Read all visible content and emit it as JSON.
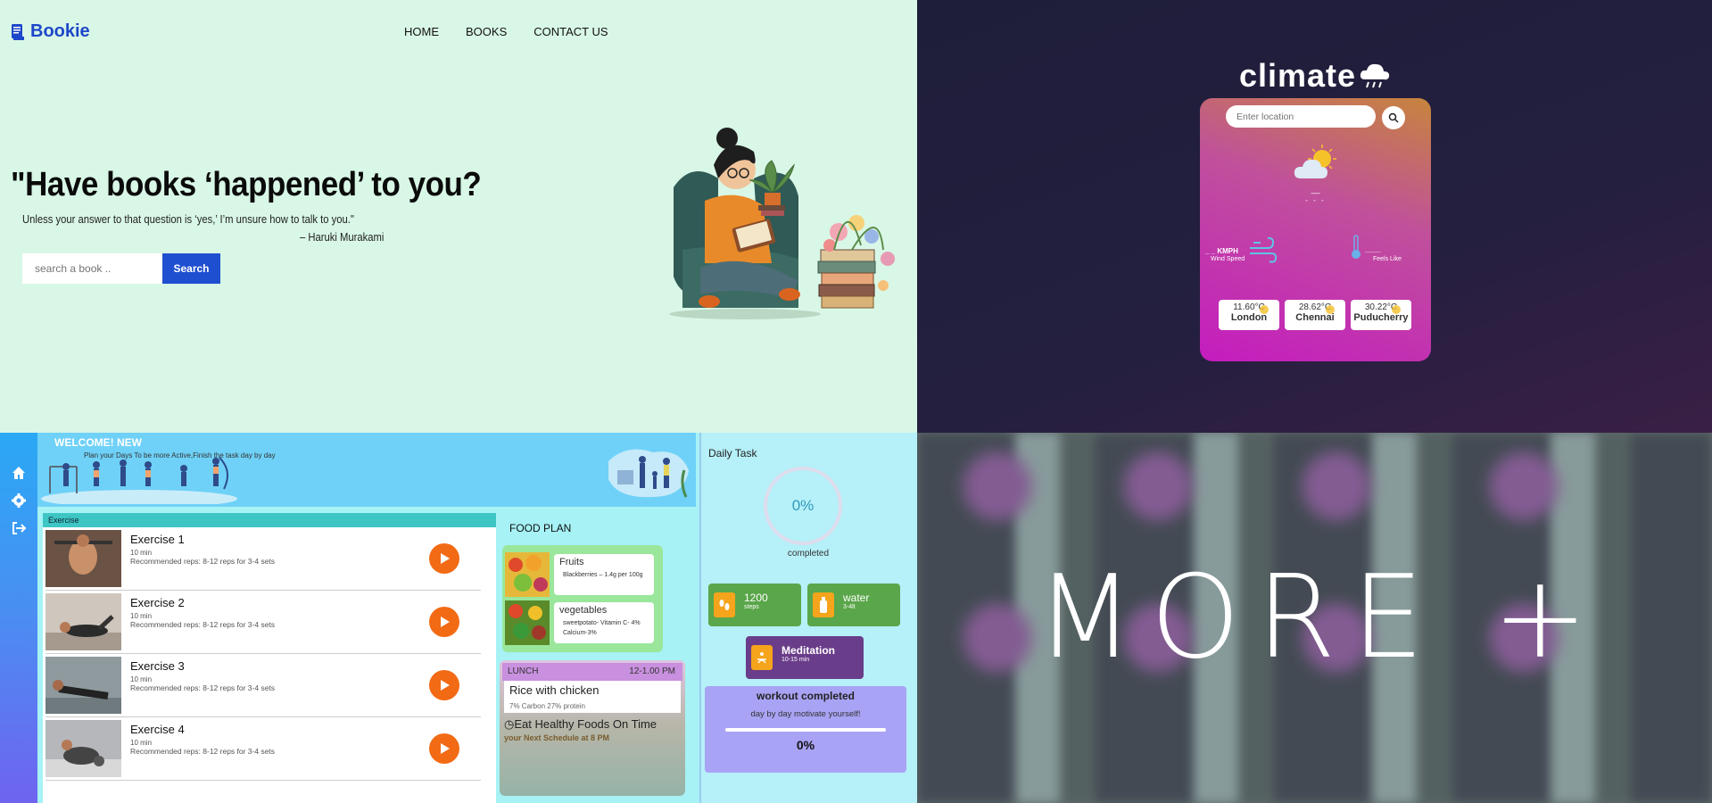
{
  "bookie": {
    "logo_text": "Bookie",
    "nav": [
      "HOME",
      "BOOKS",
      "CONTACT US"
    ],
    "headline": "\"Have books ‘happened’ to you?",
    "quote": "Unless your answer to that question is ‘yes,’ I’m unsure how to talk to you.\"",
    "author": "– Haruki Murakami",
    "search_placeholder": "search a book ..",
    "search_button": "Search"
  },
  "climate": {
    "title": "climate",
    "search_placeholder": "Enter location",
    "temp": "__ ",
    "desc": "- - -",
    "wind_value": "_ _ KMPH",
    "wind_label": "Wind Speed",
    "feels_value": "____",
    "feels_label": "Feels Like",
    "cities": [
      {
        "temp": "11.60°C",
        "name": "London"
      },
      {
        "temp": "28.62°C",
        "name": "Chennai"
      },
      {
        "temp": "30.22°C",
        "name": "Puducherry"
      }
    ]
  },
  "fitness": {
    "welcome": "WELCOME! NEW",
    "plan": "Plan your Days To be more Active,Finish the task day by day",
    "exercise_header": "Exercise",
    "exercises": [
      {
        "name": "Exercise 1",
        "min": "10 min",
        "reps": "Recommended reps: 8-12 reps for 3-4 sets"
      },
      {
        "name": "Exercise 2",
        "min": "10 min",
        "reps": "Recommended reps: 8-12 reps for 3-4 sets"
      },
      {
        "name": "Exercise 3",
        "min": "10 min",
        "reps": "Recommended reps: 8-12 reps for 3-4 sets"
      },
      {
        "name": "Exercise 4",
        "min": "10 min",
        "reps": "Recommended reps: 8-12 reps for 3-4 sets"
      }
    ],
    "food_title": "FOOD PLAN",
    "foods": [
      {
        "name": "Fruits",
        "desc": "Blackberries – 1.4g per 100g"
      },
      {
        "name": "vegetables",
        "desc": "sweetpotato- Vitamin C- 4% Calcium-3%"
      }
    ],
    "lunch_label": "LUNCH",
    "lunch_time": "12-1.00 PM",
    "lunch_meal": "Rice with chicken",
    "lunch_macros": "7% Carbon  27% protein",
    "eat_healthy": "Eat Healthy Foods On Time",
    "next_schedule": "your Next Schedule at 8 PM",
    "daily_title": "Daily Task",
    "progress": "0%",
    "completed": "completed",
    "steps_value": "1200",
    "steps_label": "steps",
    "water_value": "water",
    "water_label": "3-4lt",
    "meditation_value": "Meditation",
    "meditation_label": "10-15 min",
    "workout_title": "workout completed",
    "workout_msg": "day by day motivate yourself!",
    "workout_progress": "0%"
  },
  "more": {
    "text": "MORE +"
  }
}
